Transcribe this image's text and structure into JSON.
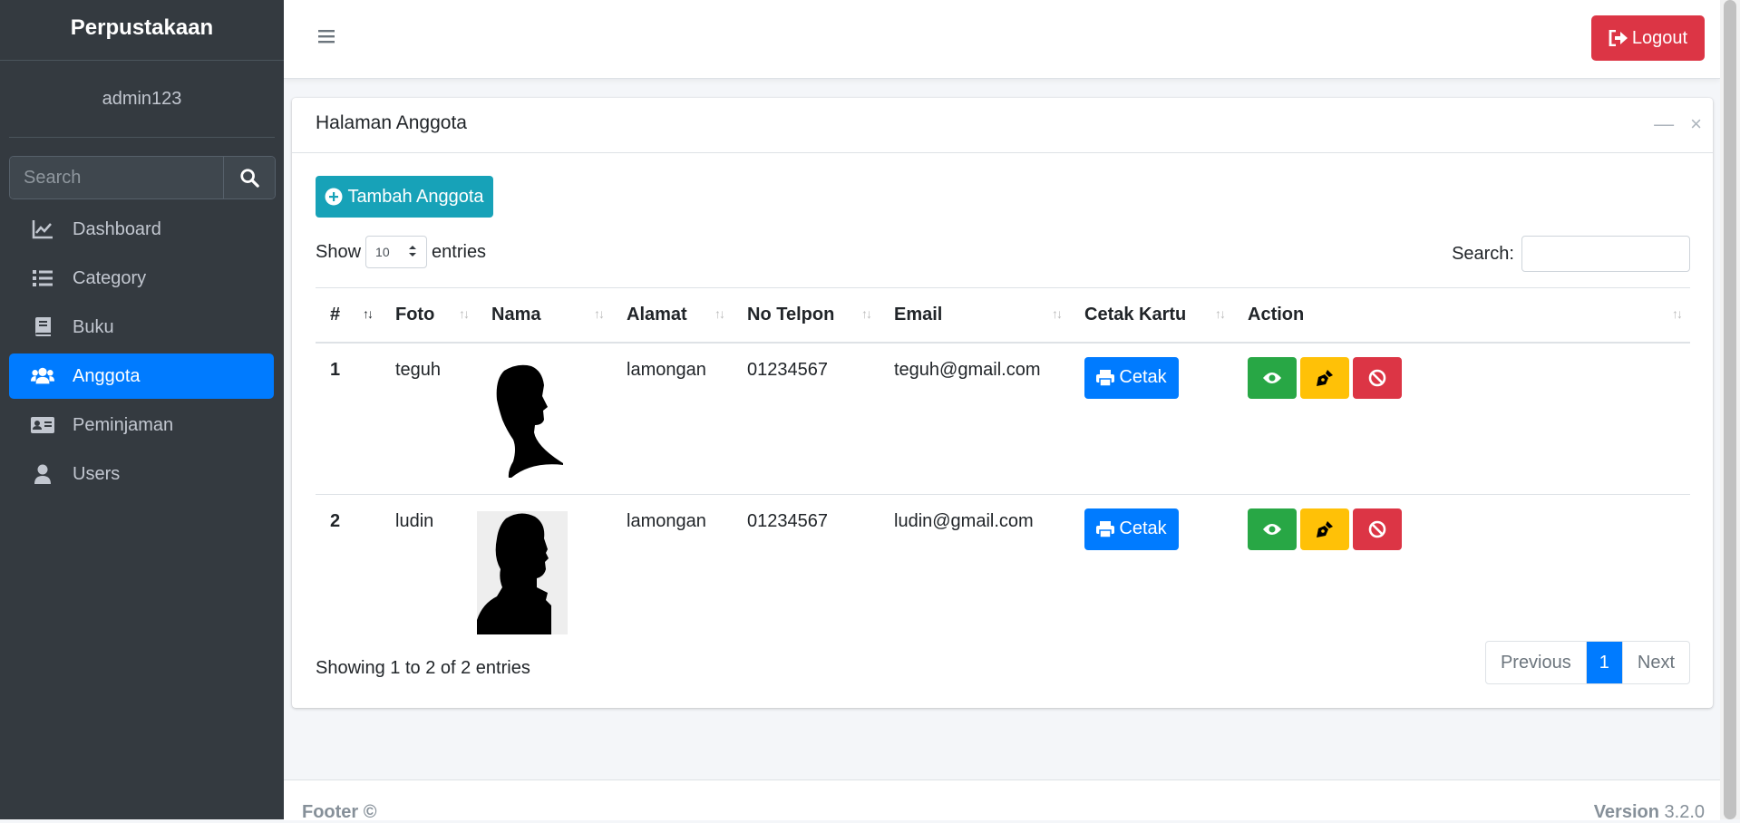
{
  "sidebar": {
    "brand": "Perpustakaan",
    "user": "admin123",
    "search_placeholder": "Search",
    "items": [
      {
        "label": "Dashboard",
        "icon": "chart-line-icon"
      },
      {
        "label": "Category",
        "icon": "list-icon"
      },
      {
        "label": "Buku",
        "icon": "book-icon"
      },
      {
        "label": "Anggota",
        "icon": "users-icon",
        "active": true
      },
      {
        "label": "Peminjaman",
        "icon": "id-card-icon"
      },
      {
        "label": "Users",
        "icon": "user-icon"
      }
    ]
  },
  "topbar": {
    "logout_label": "Logout"
  },
  "card": {
    "title": "Halaman Anggota",
    "add_button": "Tambah Anggota",
    "show_label": "Show",
    "entries_value": "10",
    "entries_label": "entries",
    "search_label": "Search:",
    "columns": [
      "#",
      "Foto",
      "Nama",
      "Alamat",
      "No Telpon",
      "Email",
      "Cetak Kartu",
      "Action"
    ],
    "rows": [
      {
        "num": "1",
        "foto": "teguh",
        "alamat": "lamongan",
        "telpon": "01234567",
        "email": "teguh@gmail.com",
        "cetak": "Cetak"
      },
      {
        "num": "2",
        "foto": "ludin",
        "alamat": "lamongan",
        "telpon": "01234567",
        "email": "ludin@gmail.com",
        "cetak": "Cetak"
      }
    ],
    "info": "Showing 1 to 2 of 2 entries",
    "pager": {
      "prev": "Previous",
      "current": "1",
      "next": "Next"
    }
  },
  "footer": {
    "left": "Footer ©",
    "version_label": "Version",
    "version": "3.2.0"
  },
  "colors": {
    "sidebar_bg": "#343a40",
    "active": "#007bff",
    "danger": "#dc3545",
    "info": "#17a2b8",
    "success": "#28a745",
    "warning": "#ffc107"
  }
}
